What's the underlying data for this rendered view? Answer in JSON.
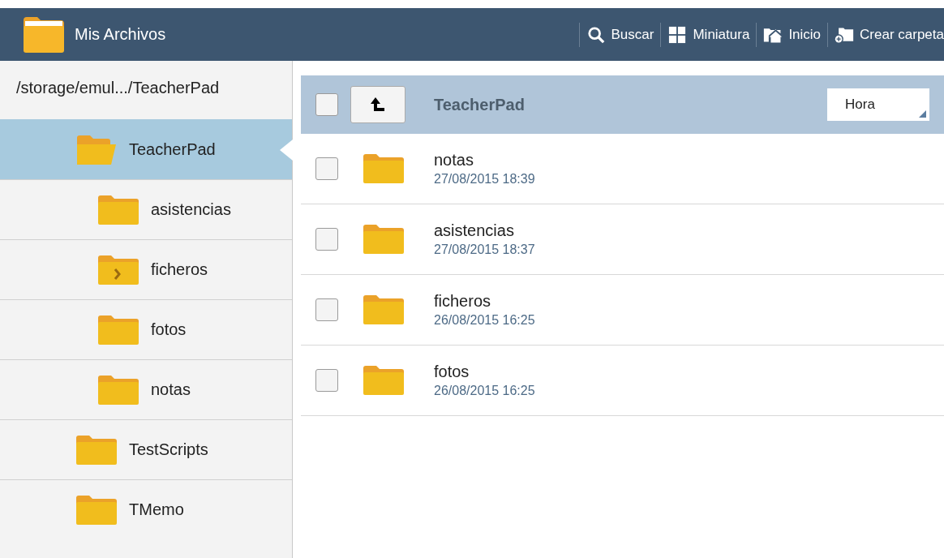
{
  "app_bar": {
    "title": "Mis Archivos",
    "actions": [
      {
        "kind": "search",
        "label": "Buscar"
      },
      {
        "kind": "grid",
        "label": "Miniatura"
      },
      {
        "kind": "home",
        "label": "Inicio"
      },
      {
        "kind": "new-folder",
        "label": "Crear carpeta"
      }
    ]
  },
  "sidebar": {
    "path": "/storage/emul.../TeacherPad",
    "tree": [
      {
        "name": "TeacherPad",
        "kind": "open",
        "selected": true,
        "children": [
          {
            "name": "asistencias",
            "kind": "closed",
            "selected": false
          },
          {
            "name": "ficheros",
            "kind": "shortcut",
            "selected": false
          },
          {
            "name": "fotos",
            "kind": "closed",
            "selected": false
          },
          {
            "name": "notas",
            "kind": "closed",
            "selected": false
          }
        ]
      },
      {
        "name": "TestScripts",
        "kind": "closed",
        "selected": false
      },
      {
        "name": "TMemo",
        "kind": "closed",
        "selected": false
      }
    ]
  },
  "list_header": {
    "checked": false,
    "folder": "TeacherPad",
    "sort": "Hora"
  },
  "files": [
    {
      "name": "notas",
      "date": "27/08/2015 18:39",
      "checked": false
    },
    {
      "name": "asistencias",
      "date": "27/08/2015 18:37",
      "checked": false
    },
    {
      "name": "ficheros",
      "date": "26/08/2015 16:25",
      "checked": false
    },
    {
      "name": "fotos",
      "date": "26/08/2015 16:25",
      "checked": false
    }
  ]
}
